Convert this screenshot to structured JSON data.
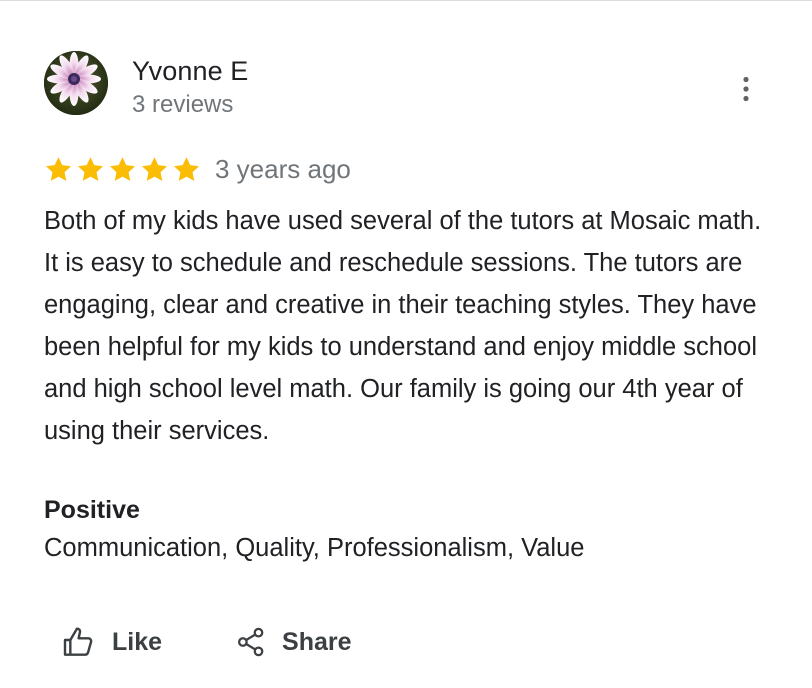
{
  "review": {
    "author_name": "Yvonne E",
    "author_reviews": "3 reviews",
    "rating": 5,
    "rating_max": 5,
    "date": "3 years ago",
    "text": "Both of my kids have used several of the tutors at Mosaic math. It is easy to schedule and reschedule sessions. The tutors are engaging, clear and creative in their teaching styles. They have been helpful for my kids to understand and enjoy middle school and high school level math. Our family is going our 4th year of using their services.",
    "positive_label": "Positive",
    "positive_values": "Communication, Quality, Professionalism, Value"
  },
  "actions": {
    "like_label": "Like",
    "share_label": "Share"
  },
  "icons": {
    "avatar": "flower-avatar",
    "more": "more-vertical-icon",
    "star": "star-icon",
    "like": "thumb-up-icon",
    "share": "share-icon"
  },
  "colors": {
    "star": "#fbbc04",
    "secondary_text": "#70757a",
    "primary_text": "#202124",
    "action_text": "#3c4043"
  }
}
